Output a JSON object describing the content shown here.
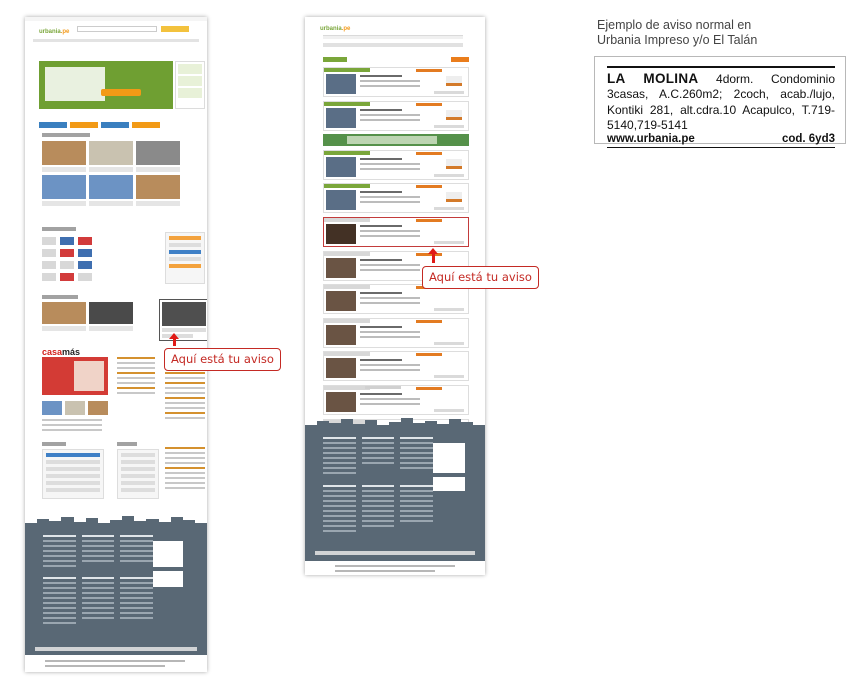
{
  "callouts": {
    "home_label": "Aquí está tu aviso",
    "results_label": "Aquí está tu aviso"
  },
  "home_page": {
    "logo_main": "urbania",
    "logo_suffix": ".pe",
    "casa_logo_prefix": "casa",
    "casa_logo_suffix": "más"
  },
  "results_page": {
    "logo_main": "urbania",
    "logo_suffix": ".pe"
  },
  "note": {
    "title_line1": "Ejemplo de aviso normal en",
    "title_line2": "Urbania Impreso y/o El Talán",
    "ad_lead": "LA MOLINA",
    "ad_body": " 4dorm. Condominio 3casas, A.C.260m2; 2coch, acab./lujo, Kontiki 281, alt.cdra.10 Acapulco, T.719-5140,719-5141",
    "ad_site": "www.urbania.pe",
    "ad_code": "cod. 6yd3"
  },
  "colors": {
    "accent_red": "#c42a24",
    "arrow_red": "#e01a16",
    "brand_green": "#7aa63a",
    "brand_orange": "#f39a1b",
    "footer_slate": "#596875"
  }
}
